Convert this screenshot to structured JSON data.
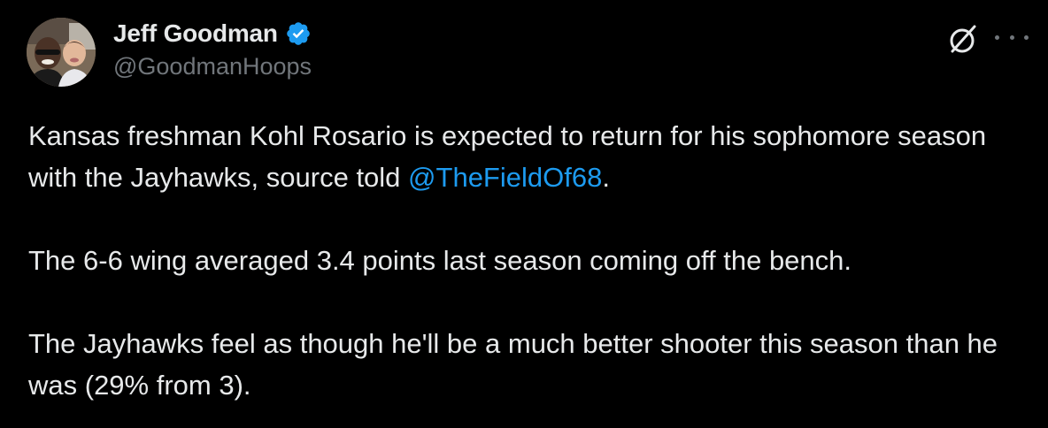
{
  "author": {
    "display_name": "Jeff Goodman",
    "handle": "@GoodmanHoops",
    "verified": true,
    "verified_color": "#1d9bf0"
  },
  "actions": {
    "grok_icon": "grok-icon",
    "more_icon": "more-icon"
  },
  "tweet": {
    "para1_before": "Kansas freshman Kohl Rosario is expected to return for his sophomore season with the Jayhawks, source told ",
    "para1_mention": "@TheFieldOf68",
    "para1_after": ".",
    "para2": "The 6-6 wing averaged 3.4 points last season coming off the bench.",
    "para3": "The Jayhawks feel as though he'll be a much better shooter this season than he was (29% from 3)."
  },
  "colors": {
    "background": "#000000",
    "text": "#e7e9ea",
    "secondary": "#71767b",
    "link": "#1d9bf0"
  }
}
